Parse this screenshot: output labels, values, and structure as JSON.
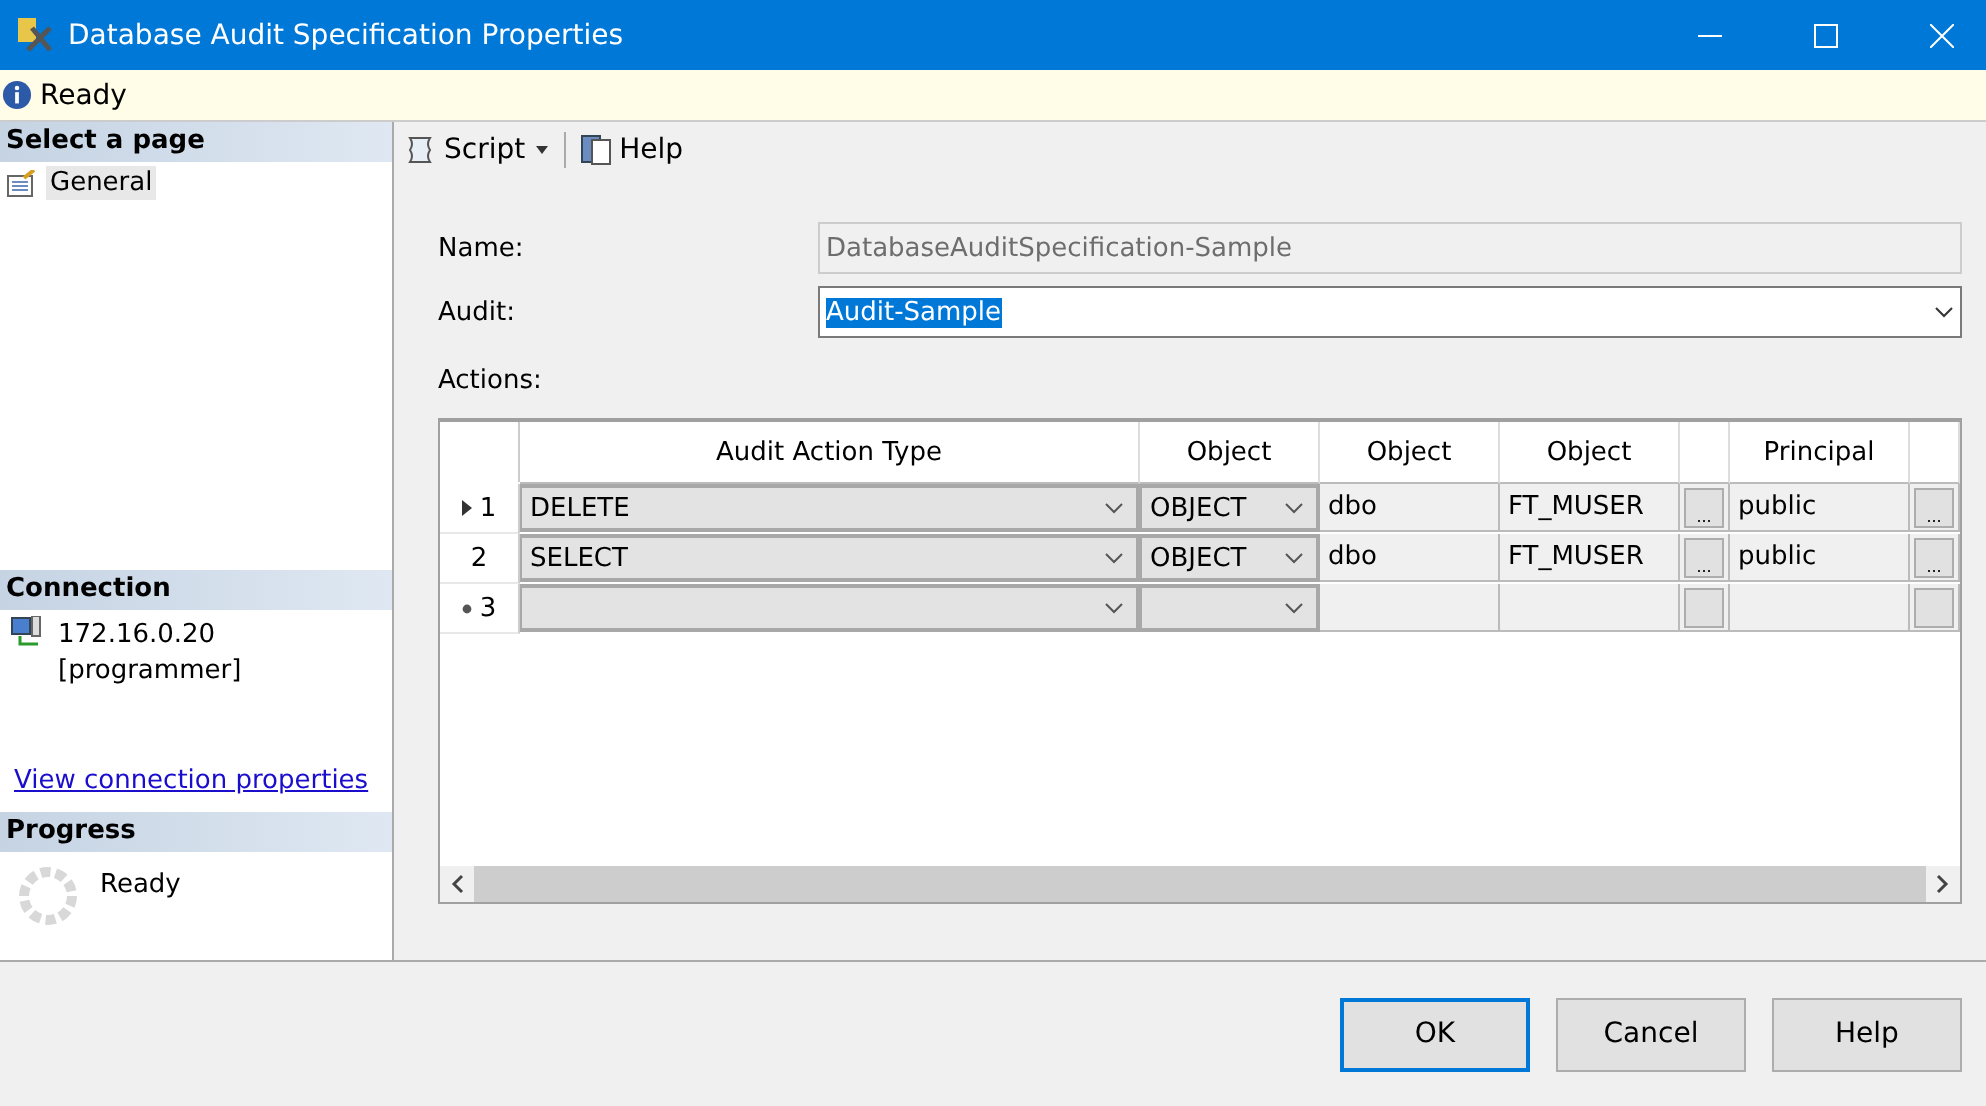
{
  "window": {
    "title": "Database Audit Specification Properties"
  },
  "status": {
    "text": "Ready"
  },
  "sidebar": {
    "select_heading": "Select a page",
    "pages": [
      {
        "label": "General",
        "selected": true
      }
    ],
    "connection_heading": "Connection",
    "server": "172.16.0.20",
    "user": "[programmer]",
    "link": "View connection properties",
    "progress_heading": "Progress",
    "progress_text": "Ready"
  },
  "toolbar": [
    {
      "kind": "script",
      "label": "Script"
    },
    {
      "kind": "help",
      "label": "Help"
    }
  ],
  "form": {
    "name_label": "Name:",
    "name_value": "DatabaseAuditSpecification-Sample",
    "name_disabled": true,
    "audit_label": "Audit:",
    "audit_value": "Audit-Sample",
    "audit_text_selected": true,
    "actions_label": "Actions:"
  },
  "table": {
    "columns": [
      {
        "label": "Audit Action Type",
        "kind": "combo"
      },
      {
        "label": "Object",
        "kind": "combo"
      },
      {
        "label": "Object",
        "kind": "text"
      },
      {
        "label": "Object",
        "kind": "text"
      },
      {
        "kind": "ellipsis"
      },
      {
        "label": "Principal",
        "kind": "text"
      },
      {
        "kind": "ellipsis"
      }
    ],
    "rows": [
      {
        "number": "1",
        "kind": "current",
        "cells": [
          "DELETE",
          "OBJECT",
          "dbo",
          "FT_MUSER",
          "...",
          "public",
          "..."
        ]
      },
      {
        "number": "2",
        "kind": "normal",
        "cells": [
          "SELECT",
          "OBJECT",
          "dbo",
          "FT_MUSER",
          "...",
          "public",
          "..."
        ]
      },
      {
        "number": "3",
        "kind": "new",
        "cells": [
          null,
          null,
          null,
          null,
          null,
          null,
          null
        ]
      }
    ]
  },
  "buttons": [
    {
      "label": "OK",
      "default": true
    },
    {
      "label": "Cancel",
      "default": false
    },
    {
      "label": "Help",
      "default": false
    }
  ]
}
